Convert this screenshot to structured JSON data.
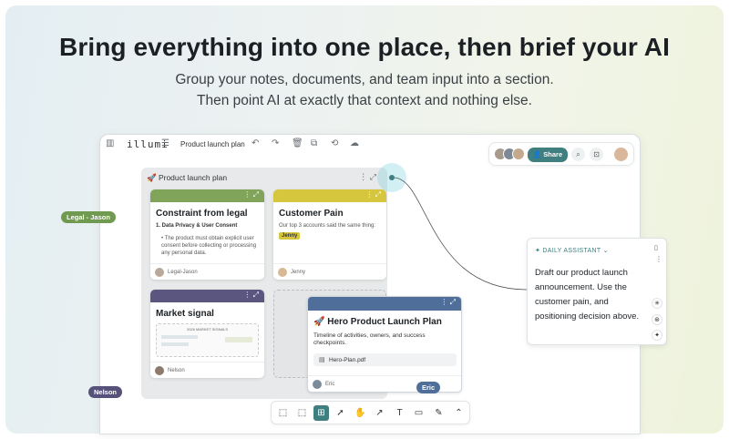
{
  "hero": {
    "headline": "Bring everything into one place, then brief your AI",
    "sub1": "Group your notes, documents, and team input into a section.",
    "sub2": "Then point AI at exactly that context and nothing else."
  },
  "app": {
    "logo": "illumi",
    "doc_title": "Product launch plan",
    "share_label": "Share"
  },
  "section": {
    "title": "Product launch plan"
  },
  "cards": {
    "legal": {
      "title": "Constraint from legal",
      "subtitle": "1. Data Privacy & User Consent",
      "body": "The product must obtain explicit user consent before collecting or processing any personal data.",
      "author": "Legal-Jason",
      "color": "#7fa45a"
    },
    "pain": {
      "title": "Customer Pain",
      "body": "Our top 3 accounts said the same thing:",
      "tag": "Jenny",
      "author": "Jenny",
      "color": "#d6c63e"
    },
    "market": {
      "title": "Market signal",
      "thumb_title": "2026 MARKET SIGNALS",
      "author": "Nelson",
      "color": "#5a5680"
    },
    "hero_plan": {
      "title": "Hero Product Launch Plan",
      "body": "Timeline of activities, owners, and success checkpoints.",
      "file": "Hero-Plan.pdf",
      "author": "Eric",
      "color": "#4f6f9a"
    }
  },
  "badges": {
    "legal": "Legal - Jason",
    "nelson": "Nelson",
    "eric": "Eric"
  },
  "assistant": {
    "label": "DAILY ASSISTANT",
    "text": "Draft our product launch announcement. Use the customer pain, and positioning decision above."
  },
  "colors": {
    "accent": "#3f7f80",
    "legal_badge": "#6f9a4f",
    "nelson_badge": "#55517a",
    "eric_badge": "#4f6f9a"
  },
  "icons": {
    "sidebar": "sidebar-icon",
    "menu": "menu-icon",
    "undo": "undo-icon",
    "redo": "redo-icon",
    "trash": "trash-icon",
    "copy": "copy-icon",
    "history": "history-icon",
    "cloud": "cloud-icon",
    "search": "search-icon",
    "focus": "focus-icon"
  }
}
